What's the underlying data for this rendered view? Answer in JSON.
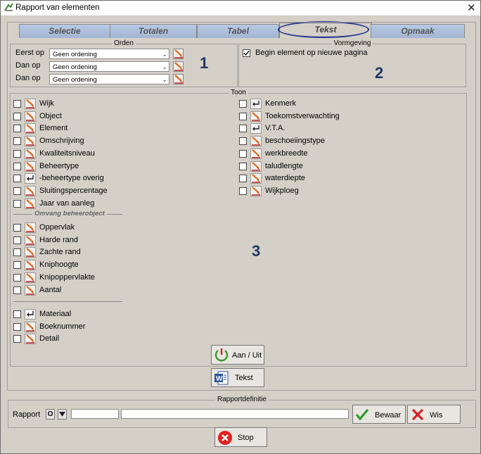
{
  "window": {
    "title": "Rapport van elementen"
  },
  "tabs": [
    "Selectie",
    "Totalen",
    "Tabel",
    "Tekst",
    "Opmaak"
  ],
  "orden": {
    "title": "Orden",
    "rows": [
      {
        "label": "Eerst op",
        "value": "Geen ordening"
      },
      {
        "label": "Dan op",
        "value": "Geen ordening"
      },
      {
        "label": "Dan op",
        "value": "Geen ordening"
      }
    ],
    "marker": "1"
  },
  "vormgeving": {
    "title": "Vormgeving",
    "checkbox_label": "Begin element op nieuwe pagina",
    "checked": true,
    "marker": "2"
  },
  "toon": {
    "title": "Toon",
    "left_items": [
      {
        "label": "Wijk",
        "icon": "pencil-icon"
      },
      {
        "label": "Object",
        "icon": "pencil-icon"
      },
      {
        "label": "Element",
        "icon": "pencil-icon"
      },
      {
        "label": "Omschrijving",
        "icon": "pencil-icon"
      },
      {
        "label": "Kwaliteitsniveau",
        "icon": "pencil-icon"
      },
      {
        "label": "Beheertype",
        "icon": "pencil-icon"
      },
      {
        "label": "-beheertype overig",
        "icon": "return-icon"
      },
      {
        "label": "Sluitingspercentage",
        "icon": "pencil-icon"
      },
      {
        "label": "Jaar van aanleg",
        "icon": "pencil-icon"
      }
    ],
    "omvang_label": "Omvang beheerobject",
    "omvang_items": [
      {
        "label": "Oppervlak",
        "icon": "pencil-icon"
      },
      {
        "label": "Harde rand",
        "icon": "pencil-icon"
      },
      {
        "label": "Zachte rand",
        "icon": "pencil-icon"
      },
      {
        "label": "Kniphoogte",
        "icon": "pencil-icon"
      },
      {
        "label": "Knipoppervlakte",
        "icon": "pencil-icon"
      },
      {
        "label": "Aantal",
        "icon": "pencil-icon"
      }
    ],
    "bottom_items": [
      {
        "label": "Materiaal",
        "icon": "return-icon"
      },
      {
        "label": "Boeknummer",
        "icon": "pencil-icon"
      },
      {
        "label": "Detail",
        "icon": "pencil-icon"
      }
    ],
    "right_items": [
      {
        "label": "Kenmerk",
        "icon": "return-icon"
      },
      {
        "label": "Toekomstverwachting",
        "icon": "pencil-icon"
      },
      {
        "label": "V.T.A.",
        "icon": "return-icon"
      },
      {
        "label": "beschoeiingstype",
        "icon": "pencil-icon"
      },
      {
        "label": "werkbreedte",
        "icon": "pencil-icon"
      },
      {
        "label": "taludlengte",
        "icon": "pencil-icon"
      },
      {
        "label": "waterdiepte",
        "icon": "pencil-icon"
      },
      {
        "label": "Wijkploeg",
        "icon": "pencil-icon"
      }
    ],
    "marker": "3",
    "toggle_button": "Aan / Uit"
  },
  "tekst_button": "Tekst",
  "rapportdefinitie": {
    "title": "Rapportdefinitie",
    "label": "Rapport",
    "o_button": "O",
    "input1": "",
    "input2": "",
    "bewaar": "Bewaar",
    "wis": "Wis"
  },
  "stop_button": "Stop",
  "colors": {
    "marker": "#1f3864",
    "tab": "#a9bcd8",
    "ellipse": "#1e2f8a"
  }
}
